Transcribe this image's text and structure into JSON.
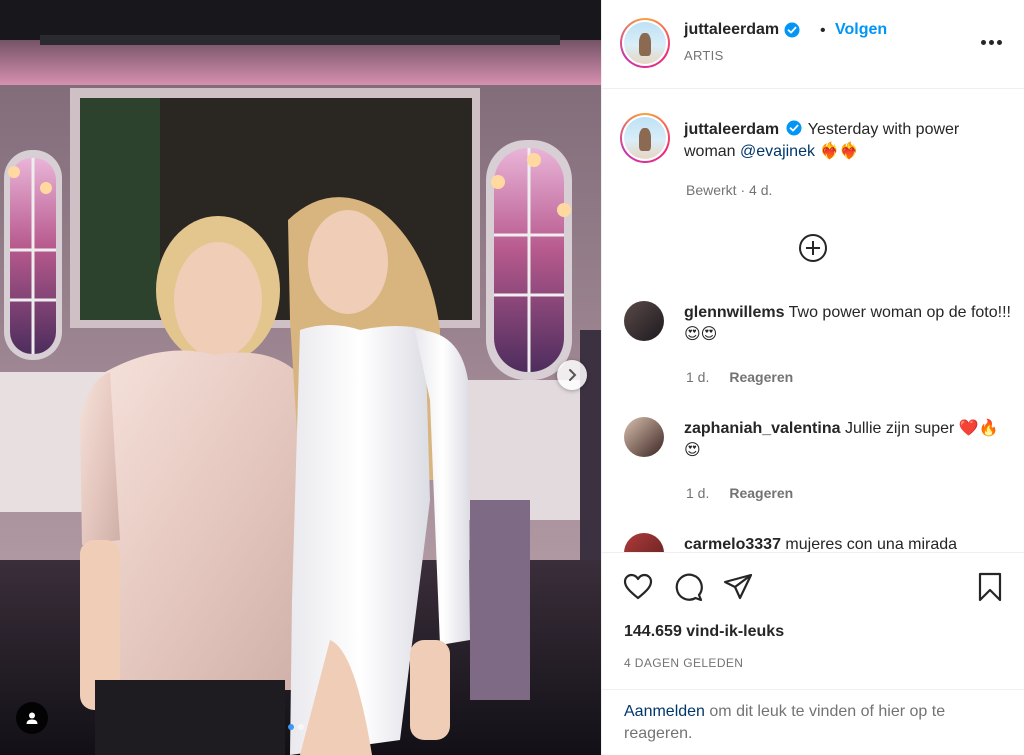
{
  "post": {
    "username": "juttaleerdam",
    "follow_label": "Volgen",
    "separator": "•",
    "subtitle": "ARTIS"
  },
  "caption": {
    "username": "juttaleerdam",
    "text": "Yesterday with power woman",
    "mention": "@evajinek",
    "emoji": "❤️‍🔥❤️‍🔥",
    "meta": "Bewerkt · 4 d."
  },
  "comments": [
    {
      "username": "glennwillems",
      "text": "Two power woman op de foto!!!😍😍",
      "time": "1 d.",
      "reply": "Reageren"
    },
    {
      "username": "zaphaniah_valentina",
      "text": "Jullie zijn super ❤️🔥😍",
      "time": "1 d.",
      "reply": "Reageren"
    },
    {
      "username": "carmelo3337",
      "text": "mujeres con una mirada",
      "time": "",
      "reply": ""
    }
  ],
  "stats": {
    "likes": "144.659 vind-ik-leuks",
    "date": "4 DAGEN GELEDEN"
  },
  "login": {
    "link": "Aanmelden",
    "text": " om dit leuk te vinden of hier op te reageren."
  },
  "icons": {
    "verified": "verified-badge-icon",
    "more": "more-options-icon",
    "load_more": "plus-circle-icon",
    "like": "heart-icon",
    "comment": "comment-icon",
    "share": "paper-plane-icon",
    "save": "bookmark-icon",
    "next": "chevron-right-icon",
    "tag": "user-tag-icon"
  },
  "colors": {
    "accent": "#0095f6",
    "link": "#00376b",
    "muted": "#737373",
    "text": "#262626"
  },
  "carousel": {
    "slides": 2,
    "active": 1
  }
}
